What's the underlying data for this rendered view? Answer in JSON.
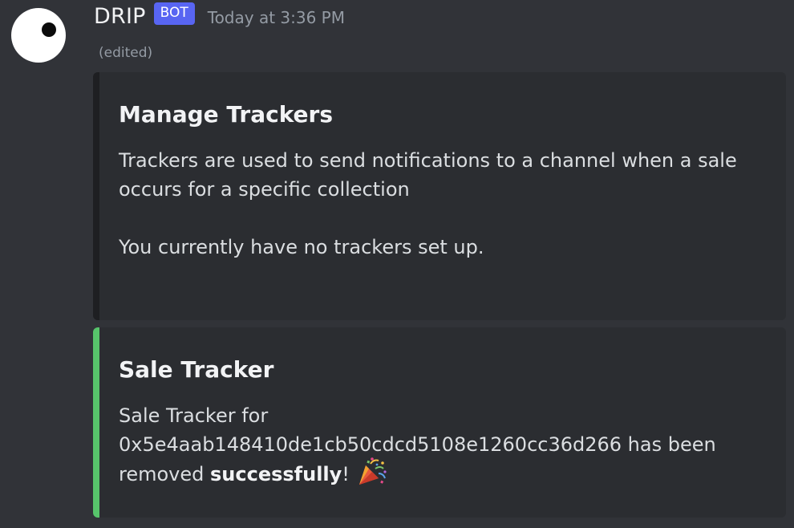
{
  "message": {
    "author": "DRIP",
    "badge": "BOT",
    "timestamp": "Today at 3:36 PM",
    "edited_label": "(edited)"
  },
  "embeds": [
    {
      "accent_color": "#1e1f22",
      "title": "Manage Trackers",
      "description_line1": "Trackers are used to send notifications to a channel when a sale occurs for a specific collection",
      "description_line2": "You currently have no trackers set up."
    },
    {
      "accent_color": "#57c46b",
      "title": "Sale Tracker",
      "description_prefix": "Sale Tracker for 0x5e4aab148410de1cb50cdcd5108e1260cc36d266 has been removed ",
      "description_bold": "successfully",
      "description_suffix": "!",
      "emoji": "party-popper-icon"
    }
  ],
  "colors": {
    "background": "#313338",
    "embed_background": "#2b2d31",
    "badge": "#5865f2",
    "muted_text": "#949ba4"
  }
}
